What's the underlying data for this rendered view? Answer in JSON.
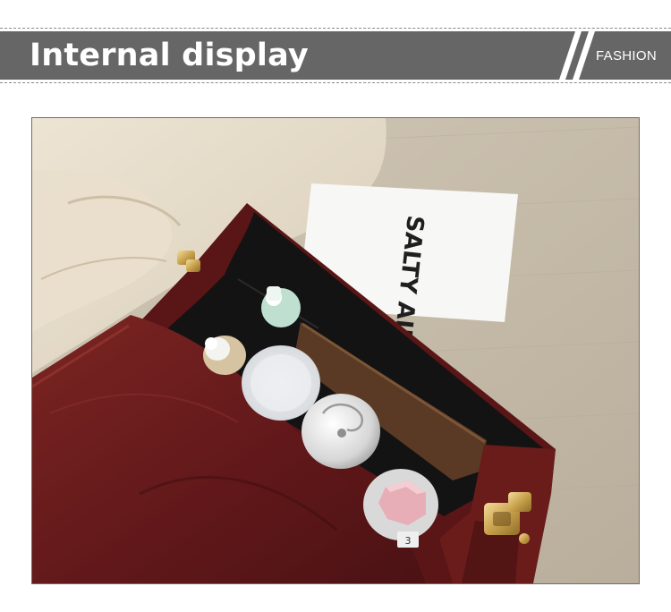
{
  "banner": {
    "title": "Internal display",
    "tag": "FASHION",
    "bar_color": "#666666",
    "text_color": "#ffffff"
  },
  "photo": {
    "card_text": "SALTY AIR",
    "bottle_label": "3",
    "bag_color": "#6b1a18",
    "interior_color": "#151515",
    "background_color": "#c7bba8"
  }
}
